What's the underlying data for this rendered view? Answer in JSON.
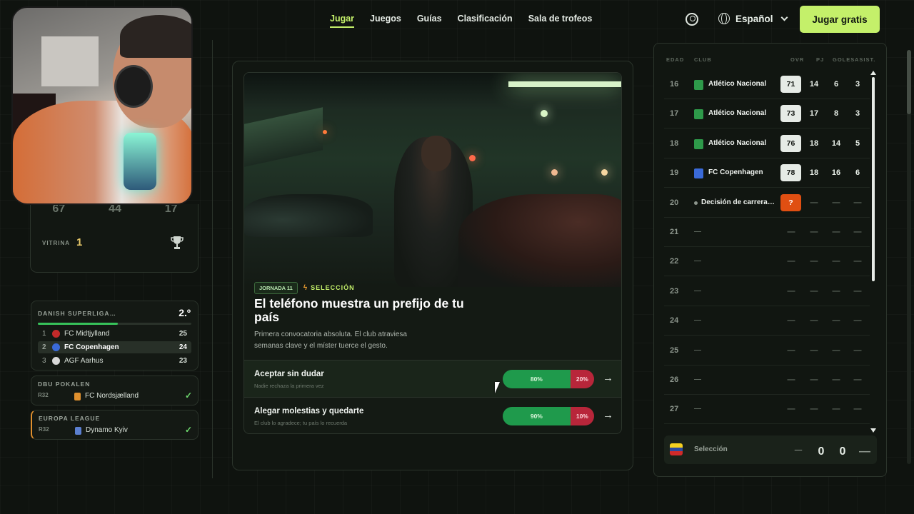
{
  "nav": {
    "links": [
      "Jugar",
      "Juegos",
      "Guías",
      "Clasificación",
      "Sala de trofeos"
    ],
    "language": "Español",
    "cta": "Jugar gratis"
  },
  "stats": {
    "values": [
      "67",
      "44",
      "17"
    ],
    "vitrina_label": "VITRINA",
    "vitrina_count": "1"
  },
  "league": {
    "name": "DANISH SUPERLIGA…",
    "position": "2.º",
    "progress": 0.52,
    "rows": [
      {
        "pos": "1",
        "team": "FC Midtjylland",
        "pts": "25",
        "color": "#c42a2a"
      },
      {
        "pos": "2",
        "team": "FC Copenhagen",
        "pts": "24",
        "color": "#3a6ad8"
      },
      {
        "pos": "3",
        "team": "AGF Aarhus",
        "pts": "23",
        "color": "#d8d8d8"
      }
    ]
  },
  "cups": [
    {
      "name": "DBU POKALEN",
      "round": "R32",
      "team": "FC Nordsjælland",
      "check": "✓",
      "crest_color": "#e0902e"
    },
    {
      "name": "EUROPA LEAGUE",
      "round": "R32",
      "team": "Dynamo Kyiv",
      "check": "✓",
      "crest_color": "#5b7fd0"
    }
  ],
  "event": {
    "jornada": "JORNADA 11",
    "tag": "SELECCIÓN",
    "title": "El teléfono muestra un prefijo de tu país",
    "description": "Primera convocatoria absoluta. El club atraviesa semanas clave y el míster tuerce el gesto.",
    "options": [
      {
        "title": "Aceptar sin dudar",
        "subtitle": "Nadie rechaza la primera vez",
        "yes": "80%",
        "no": "20%",
        "yes_frac": 0.74
      },
      {
        "title": "Alegar molestias y quedarte",
        "subtitle": "El club lo agradece; tu país lo recuerda",
        "yes": "90%",
        "no": "10%",
        "yes_frac": 0.74
      }
    ]
  },
  "career": {
    "headers": {
      "age": "EDAD",
      "club": "CLUB",
      "ovr": "OVR",
      "pj": "PJ",
      "goals": "GOLES",
      "assists": "ASIST."
    },
    "rows": [
      {
        "age": "16",
        "club": "Atlético Nacional",
        "ovr": "71",
        "pj": "14",
        "goals": "6",
        "assists": "3",
        "crest": "#2e9a4a"
      },
      {
        "age": "17",
        "club": "Atlético Nacional",
        "ovr": "73",
        "pj": "17",
        "goals": "8",
        "assists": "3",
        "crest": "#2e9a4a"
      },
      {
        "age": "18",
        "club": "Atlético Nacional",
        "ovr": "76",
        "pj": "18",
        "goals": "14",
        "assists": "5",
        "crest": "#2e9a4a"
      },
      {
        "age": "19",
        "club": "FC Copenhagen",
        "ovr": "78",
        "pj": "18",
        "goals": "16",
        "assists": "6",
        "crest": "#3a6ad8"
      },
      {
        "age": "20",
        "club": "Decisión de carrera…",
        "ovr": "?",
        "pj": "—",
        "goals": "—",
        "assists": "—",
        "crest": ""
      },
      {
        "age": "21",
        "club": "—",
        "ovr": "—",
        "pj": "—",
        "goals": "—",
        "assists": "—",
        "crest": ""
      },
      {
        "age": "22",
        "club": "—",
        "ovr": "—",
        "pj": "—",
        "goals": "—",
        "assists": "—",
        "crest": ""
      },
      {
        "age": "23",
        "club": "—",
        "ovr": "—",
        "pj": "—",
        "goals": "—",
        "assists": "—",
        "crest": ""
      },
      {
        "age": "24",
        "club": "—",
        "ovr": "—",
        "pj": "—",
        "goals": "—",
        "assists": "—",
        "crest": ""
      },
      {
        "age": "25",
        "club": "—",
        "ovr": "—",
        "pj": "—",
        "goals": "—",
        "assists": "—",
        "crest": ""
      },
      {
        "age": "26",
        "club": "—",
        "ovr": "—",
        "pj": "—",
        "goals": "—",
        "assists": "—",
        "crest": ""
      },
      {
        "age": "27",
        "club": "—",
        "ovr": "—",
        "pj": "—",
        "goals": "—",
        "assists": "—",
        "crest": ""
      }
    ],
    "selection": {
      "label": "Selección",
      "ovr": "—",
      "pj": "0",
      "goals": "0",
      "assists": "—"
    }
  },
  "colors": {
    "accent": "#c4f06a",
    "yes": "#1f9a4c",
    "no": "#b8263a",
    "unknown": "#e04f12"
  }
}
